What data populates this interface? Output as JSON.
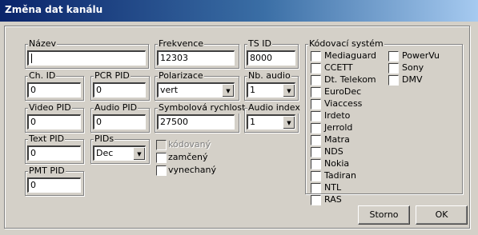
{
  "window": {
    "title": "Změna dat kanálu"
  },
  "fields": {
    "nazev": {
      "label": "Název",
      "value": ""
    },
    "frekvence": {
      "label": "Frekvence",
      "value": "12303"
    },
    "ts_id": {
      "label": "TS ID",
      "value": "8000"
    },
    "ch_id": {
      "label": "Ch. ID",
      "value": "0"
    },
    "pcr_pid": {
      "label": "PCR PID",
      "value": "0"
    },
    "polarizace": {
      "label": "Polarizace",
      "value": "vert"
    },
    "nb_audio": {
      "label": "Nb. audio",
      "value": "1"
    },
    "video_pid": {
      "label": "Video PID",
      "value": "0"
    },
    "audio_pid": {
      "label": "Audio PID",
      "value": "0"
    },
    "symbolova_rychlost": {
      "label": "Symbolová rychlost",
      "value": "27500"
    },
    "audio_index": {
      "label": "Audio index",
      "value": "1"
    },
    "text_pid": {
      "label": "Text PID",
      "value": "0"
    },
    "pids": {
      "label": "PIDs",
      "value": "Dec"
    },
    "pmt_pid": {
      "label": "PMT PID",
      "value": "0"
    }
  },
  "flags": [
    {
      "label": "kódovaný",
      "checked": false,
      "disabled": true
    },
    {
      "label": "zamčený",
      "checked": false,
      "disabled": false
    },
    {
      "label": "vynechaný",
      "checked": false,
      "disabled": false
    }
  ],
  "encoding": {
    "label": "Kódovací systém",
    "col1": [
      "Mediaguard",
      "CCETT",
      "Dt. Telekom",
      "EuroDec",
      "Viaccess",
      "Irdeto",
      "Jerrold",
      "Matra",
      "NDS",
      "Nokia",
      "Tadiran",
      "NTL",
      "RAS"
    ],
    "col2": [
      "PowerVu",
      "Sony",
      "DMV"
    ]
  },
  "buttons": {
    "storno": "Storno",
    "ok": "OK"
  }
}
